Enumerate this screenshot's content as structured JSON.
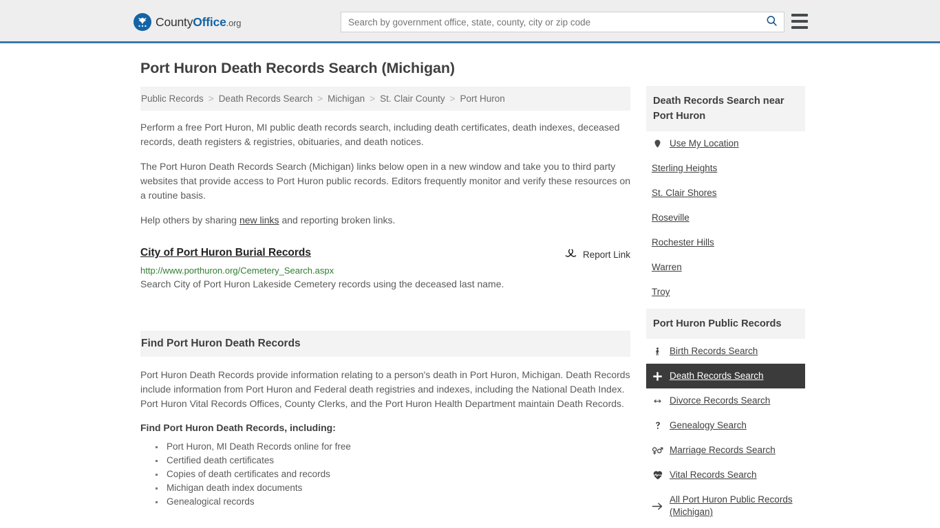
{
  "header": {
    "logo": {
      "icon": "eagle-seal-icon",
      "text_county": "County",
      "text_office": "Office",
      "text_org": ".org"
    },
    "search": {
      "placeholder": "Search by government office, state, county, city or zip code",
      "value": "",
      "button_icon": "search-icon"
    },
    "menu_icon": "hamburger-menu-icon",
    "accent_color": "#3b78ae"
  },
  "main": {
    "title": "Port Huron Death Records Search (Michigan)",
    "breadcrumb": [
      "Public Records",
      "Death Records Search",
      "Michigan",
      "St. Clair County",
      "Port Huron"
    ],
    "breadcrumb_separator": ">",
    "paragraphs": [
      "Perform a free Port Huron, MI public death records search, including death certificates, death indexes, deceased records, death registers & registries, obituaries, and death notices.",
      "The Port Huron Death Records Search (Michigan) links below open in a new window and take you to third party websites that provide access to Port Huron public records. Editors frequently monitor and verify these resources on a routine basis."
    ],
    "help_line": {
      "before": "Help others by sharing ",
      "link": "new links",
      "after": " and reporting broken links."
    },
    "result": {
      "title": "City of Port Huron Burial Records",
      "url": "http://www.porthuron.org/Cemetery_Search.aspx",
      "description": "Search City of Port Huron Lakeside Cemetery records using the deceased last name.",
      "report_label": "Report Link",
      "report_icon": "broken-link-icon",
      "url_color": "#2f7d32"
    },
    "section": {
      "heading": "Find Port Huron Death Records",
      "paragraph": "Port Huron Death Records provide information relating to a person's death in Port Huron, Michigan. Death Records include information from Port Huron and Federal death registries and indexes, including the National Death Index. Port Huron Vital Records Offices, County Clerks, and the Port Huron Health Department maintain Death Records.",
      "sub_heading": "Find Port Huron Death Records, including:",
      "bullets": [
        "Port Huron, MI Death Records online for free",
        "Certified death certificates",
        "Copies of death certificates and records",
        "Michigan death index documents",
        "Genealogical records"
      ]
    }
  },
  "sidebar": {
    "nearby": {
      "heading": "Death Records Search near Port Huron",
      "items": [
        {
          "label": "Use My Location",
          "icon": "map-pin-icon"
        },
        {
          "label": "Sterling Heights",
          "icon": ""
        },
        {
          "label": "St. Clair Shores",
          "icon": ""
        },
        {
          "label": "Roseville",
          "icon": ""
        },
        {
          "label": "Rochester Hills",
          "icon": ""
        },
        {
          "label": "Warren",
          "icon": ""
        },
        {
          "label": "Troy",
          "icon": ""
        }
      ]
    },
    "public_records": {
      "heading": "Port Huron Public Records",
      "active_index": 1,
      "active_bg": "#3b3b3b",
      "items": [
        {
          "label": "Birth Records Search",
          "icon": "child-icon"
        },
        {
          "label": "Death Records Search",
          "icon": "cross-icon"
        },
        {
          "label": "Divorce Records Search",
          "icon": "arrows-split-icon"
        },
        {
          "label": "Genealogy Search",
          "icon": "question-mark-icon"
        },
        {
          "label": "Marriage Records Search",
          "icon": "gender-symbols-icon"
        },
        {
          "label": "Vital Records Search",
          "icon": "heartbeat-icon"
        },
        {
          "label": "All Port Huron Public Records (Michigan)",
          "icon": "arrow-right-icon"
        }
      ]
    }
  }
}
